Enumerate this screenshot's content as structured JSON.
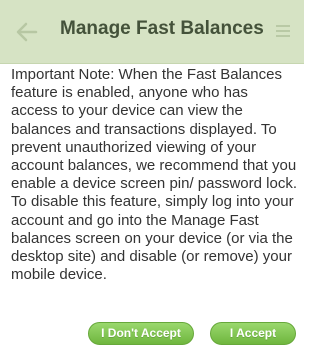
{
  "header": {
    "title": "Manage Fast Balances",
    "back_icon": "arrow-left-icon",
    "menu_icon": "hamburger-menu-icon"
  },
  "note": {
    "text": "Important Note: When the Fast Balances feature is enabled, anyone who has access to your device can view the balances and transactions displayed. To prevent unauthorized viewing of your account balances, we recommend that you enable a device screen pin/ password lock. To disable this feature, simply log into your account and go into the Manage Fast balances screen on your device (or via the desktop site) and disable (or remove) your mobile device."
  },
  "actions": {
    "decline_label": "I Don't Accept",
    "accept_label": "I Accept"
  },
  "colors": {
    "header_bg": "#d6e3c4",
    "title": "#44523a",
    "button_green": "#7cc24b",
    "text": "#333333"
  }
}
